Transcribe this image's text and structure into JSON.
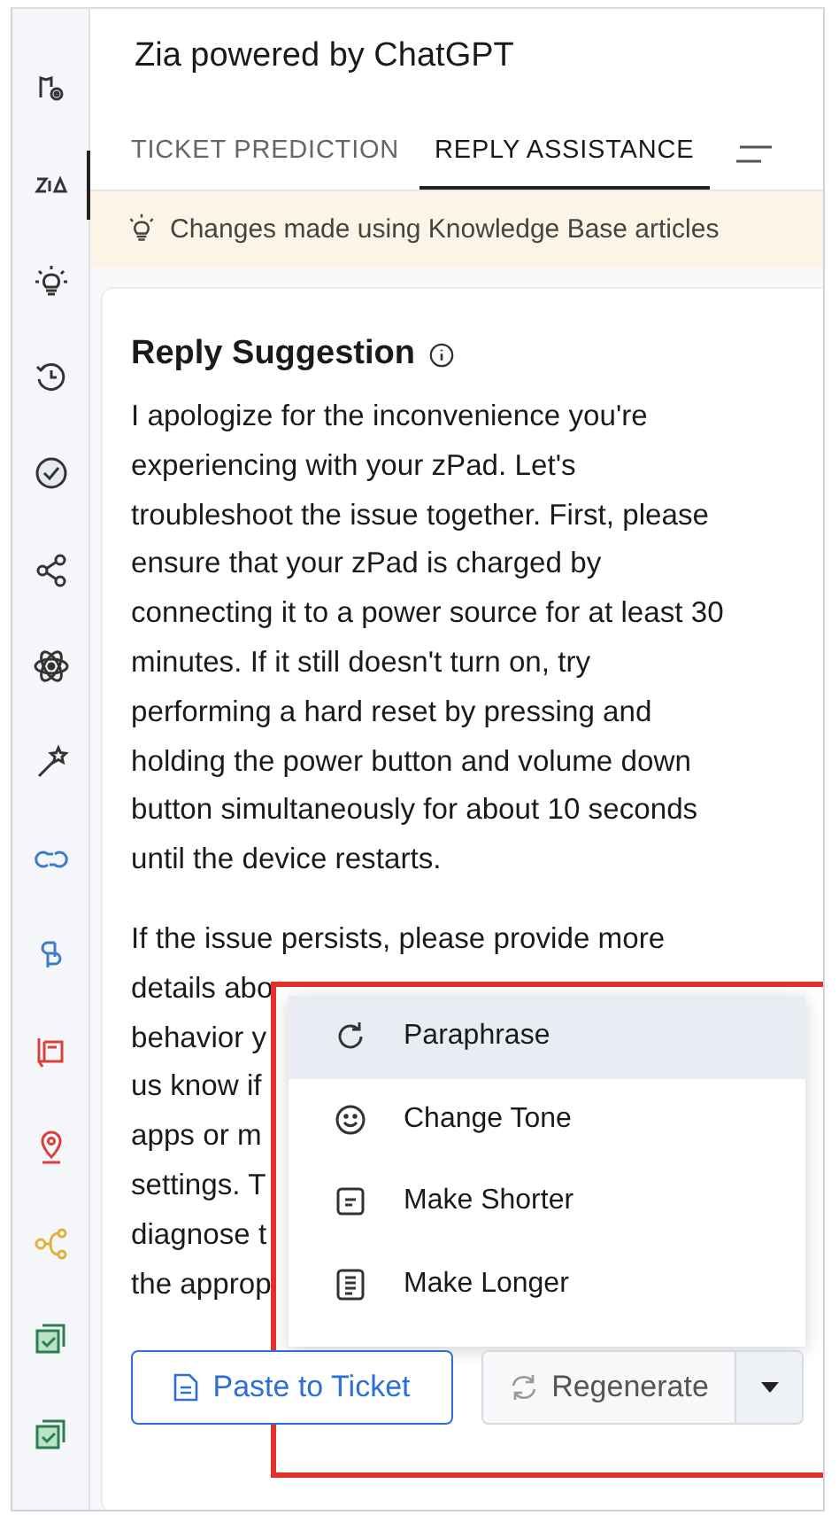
{
  "sidebar": {
    "items": [
      {
        "kind": "settings",
        "selected": false
      },
      {
        "kind": "zia",
        "selected": true
      },
      {
        "kind": "bulb",
        "selected": false
      },
      {
        "kind": "history",
        "selected": false
      },
      {
        "kind": "check",
        "selected": false
      },
      {
        "kind": "share",
        "selected": false
      },
      {
        "kind": "atom",
        "selected": false
      },
      {
        "kind": "wand",
        "selected": false
      },
      {
        "kind": "link",
        "selected": false
      },
      {
        "kind": "stack",
        "selected": false
      },
      {
        "kind": "book",
        "selected": false
      },
      {
        "kind": "pin",
        "selected": false
      },
      {
        "kind": "flow",
        "selected": false
      },
      {
        "kind": "ticket",
        "selected": false
      },
      {
        "kind": "ticket",
        "selected": false
      }
    ]
  },
  "title": "Zia powered by ChatGPT",
  "tabs": [
    {
      "label": "TICKET PREDICTION",
      "selected": false
    },
    {
      "label": "REPLY ASSISTANCE",
      "selected": true
    }
  ],
  "banner": "Changes made using Knowledge Base articles",
  "card": {
    "heading": "Reply Suggestion",
    "paragraphs": [
      [
        "I apologize for the inconvenience you're",
        "experiencing with your zPad. Let's",
        "troubleshoot the issue together. First, please",
        "ensure that your zPad is charged by",
        "connecting it to a power source for at least 30",
        "minutes. If it still doesn't turn on, try",
        "performing a hard reset by pressing and",
        "holding the power button and volume down",
        "button simultaneously for about 10 seconds",
        "until the device restarts."
      ],
      [
        "If the issue persists, please provide more",
        "details abo",
        "behavior y",
        "us know if",
        "apps or m",
        "settings. T",
        "diagnose t",
        "the approp"
      ]
    ],
    "paste_button": "Paste to Ticket",
    "regenerate_button": "Regenerate"
  },
  "menu": [
    {
      "kind": "refresh",
      "label": "Paraphrase",
      "selected": true
    },
    {
      "kind": "smile",
      "label": "Change Tone",
      "selected": false
    },
    {
      "kind": "short",
      "label": "Make Shorter",
      "selected": false
    },
    {
      "kind": "long",
      "label": "Make Longer",
      "selected": false
    }
  ]
}
